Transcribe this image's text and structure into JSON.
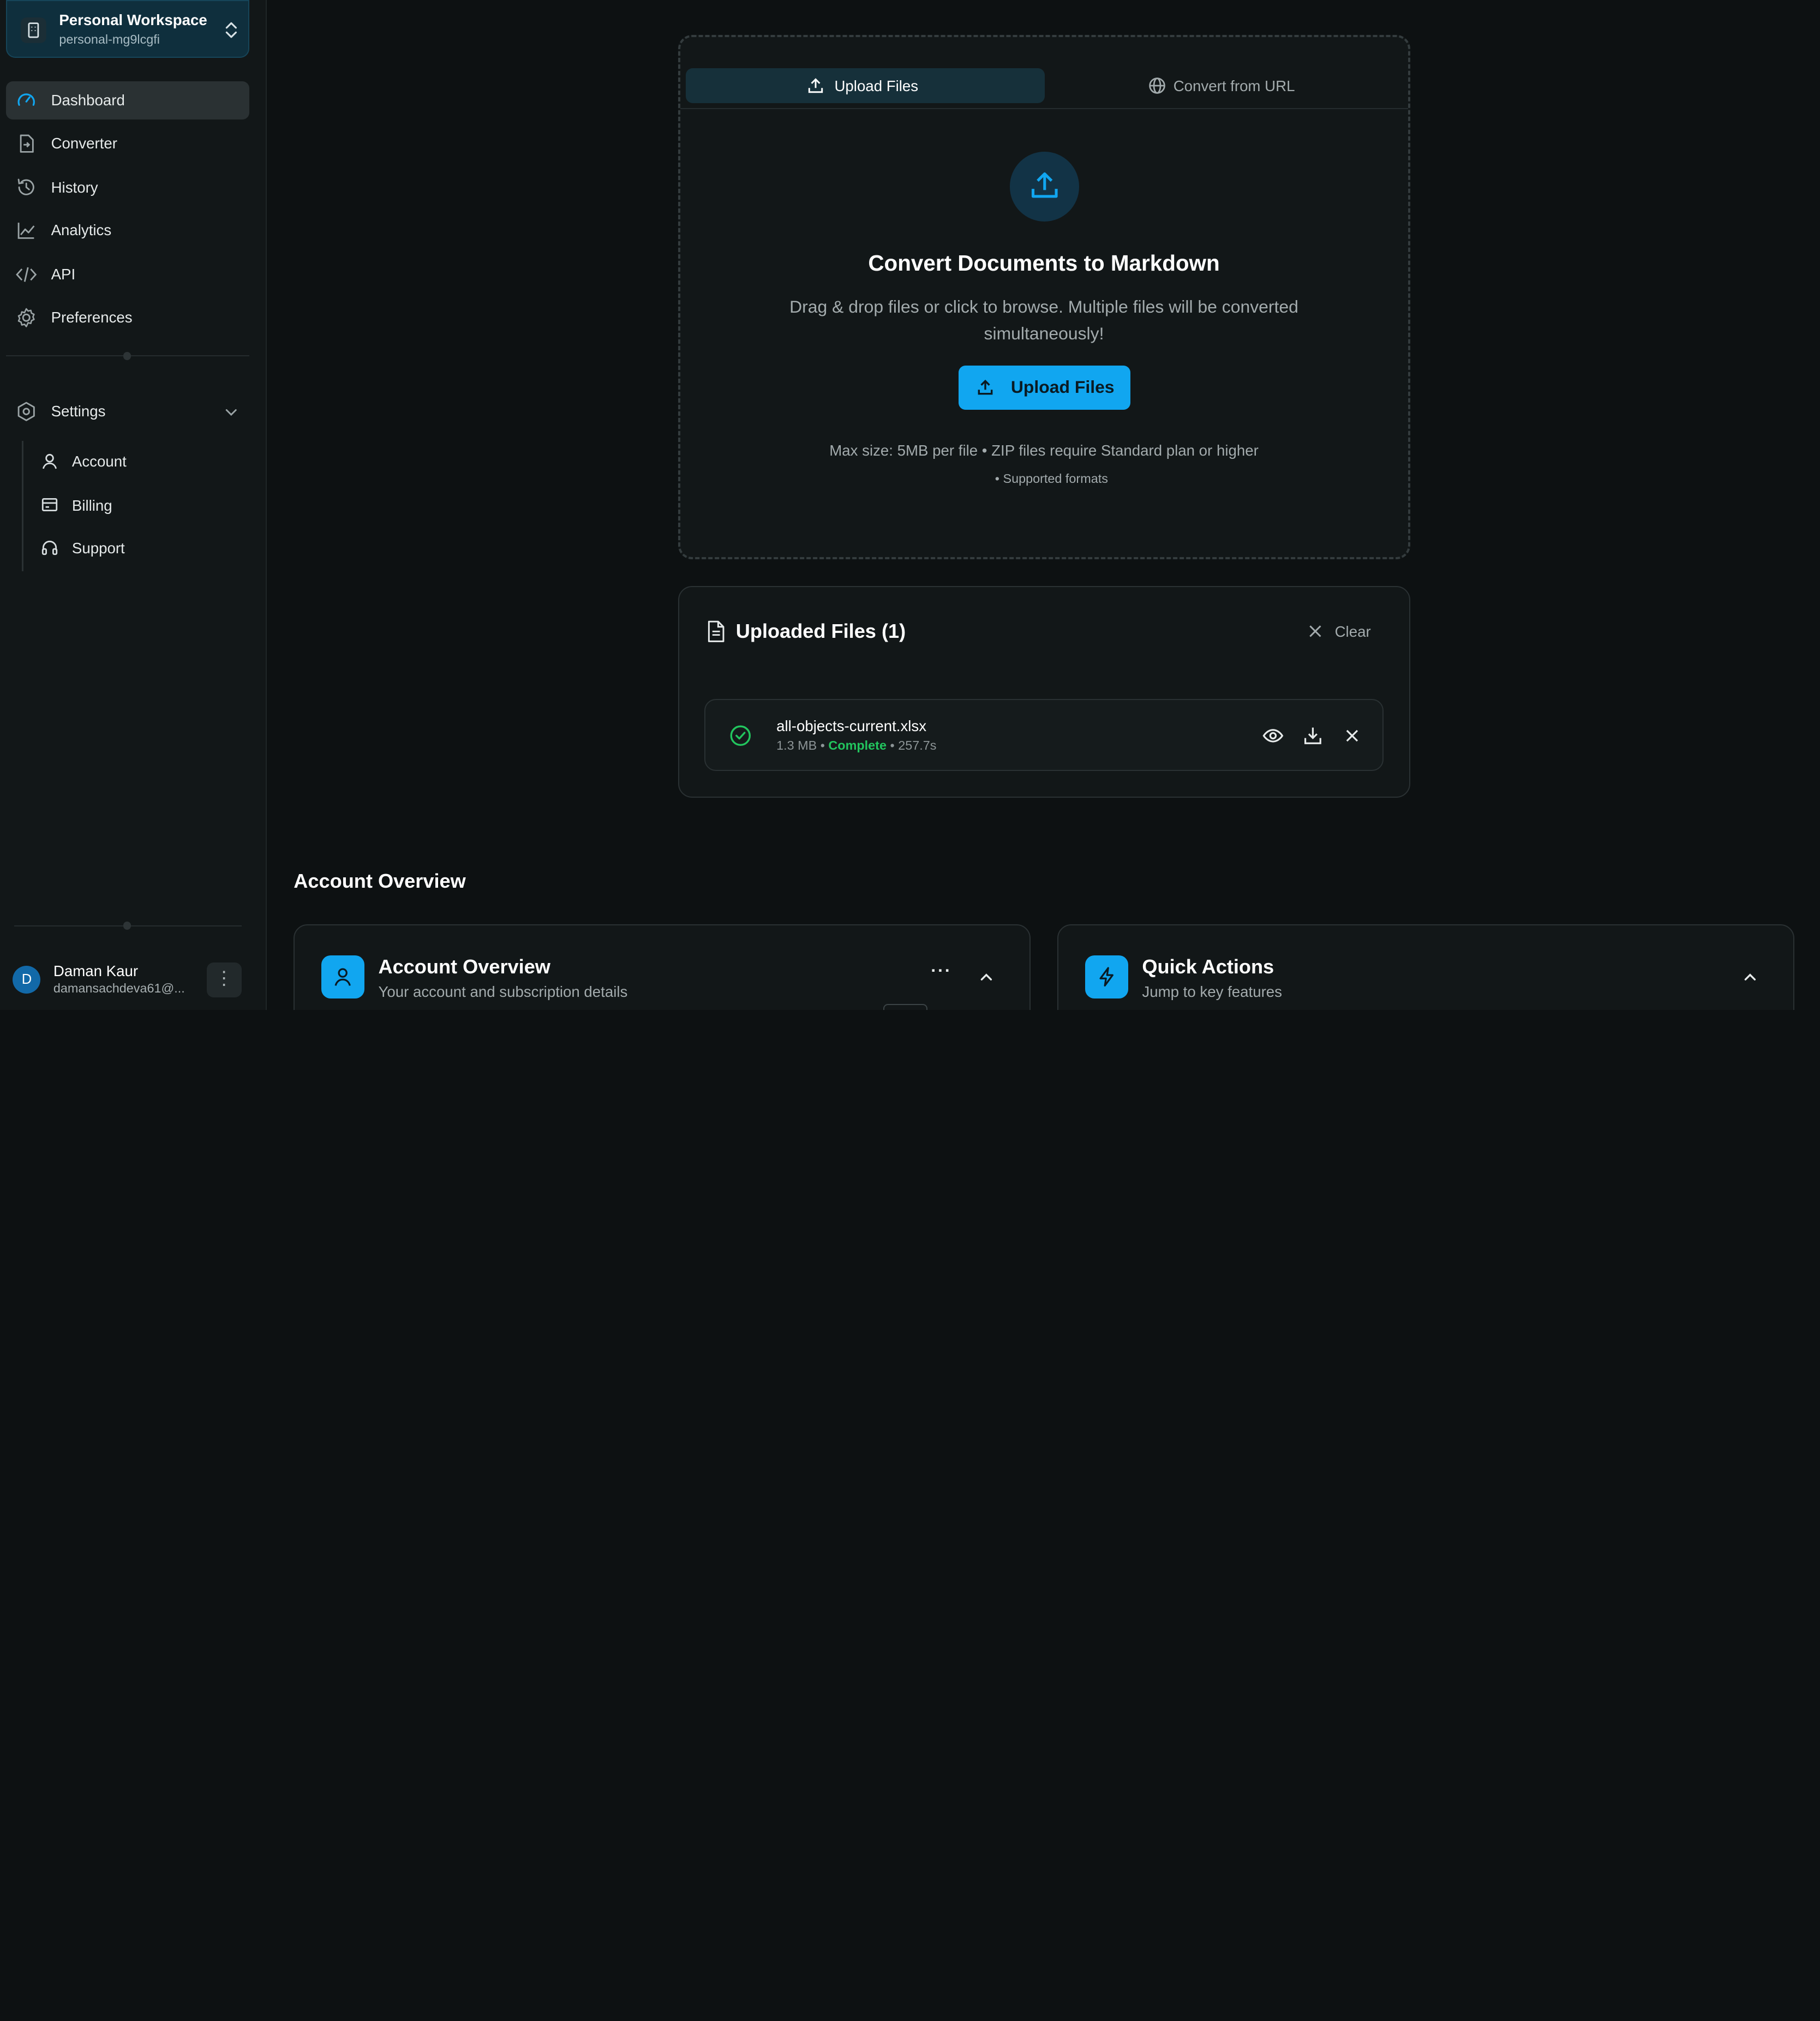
{
  "workspace": {
    "name": "Personal Workspace",
    "id": "personal-mg9lcgfi"
  },
  "nav": [
    {
      "label": "Dashboard",
      "icon": "dashboard-gauge-icon",
      "active": true
    },
    {
      "label": "Converter",
      "icon": "file-convert-icon"
    },
    {
      "label": "History",
      "icon": "history-icon"
    },
    {
      "label": "Analytics",
      "icon": "analytics-chart-icon"
    },
    {
      "label": "API",
      "icon": "code-icon"
    },
    {
      "label": "Preferences",
      "icon": "gear-icon"
    }
  ],
  "settings": {
    "label": "Settings",
    "items": [
      {
        "label": "Account",
        "icon": "user-icon"
      },
      {
        "label": "Billing",
        "icon": "billing-card-icon"
      },
      {
        "label": "Support",
        "icon": "headset-icon"
      }
    ]
  },
  "user": {
    "initial": "D",
    "name": "Daman Kaur",
    "email": "damansachdeva61@..."
  },
  "upload": {
    "tabs": [
      {
        "label": "Upload Files",
        "active": true
      },
      {
        "label": "Convert from URL"
      }
    ],
    "title": "Convert Documents to Markdown",
    "description": "Drag & drop files or click to browse. Multiple files will be converted simultaneously!",
    "button": "Upload Files",
    "note": "Max size: 5MB per file • ZIP files require Standard plan or higher",
    "formats": "• Supported formats"
  },
  "files": {
    "title": "Uploaded Files (1)",
    "clear": "Clear",
    "items": [
      {
        "name": "all-objects-current.xlsx",
        "size": "1.3 MB",
        "status": "Complete",
        "time": "257.7s"
      }
    ]
  },
  "overview": {
    "section_title": "Account Overview",
    "cards": [
      {
        "title": "Account Overview",
        "subtitle": "Your account and subscription details"
      },
      {
        "title": "Quick Actions",
        "subtitle": "Jump to key features"
      }
    ]
  },
  "colors": {
    "accent": "#11a6f0",
    "success": "#22c55e",
    "background": "#0d1112",
    "sidebar": "#121718"
  }
}
